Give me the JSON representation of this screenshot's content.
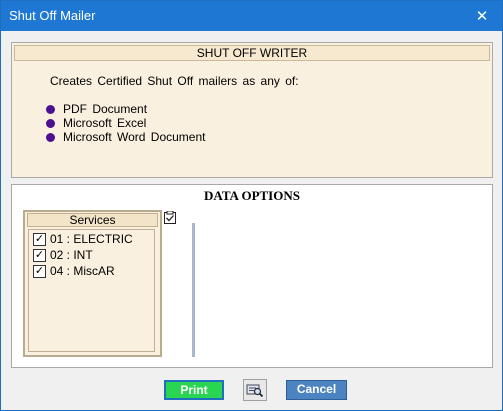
{
  "window": {
    "title": "Shut Off Mailer",
    "close_glyph": "✕"
  },
  "writer_panel": {
    "header": "SHUT OFF WRITER",
    "description": "Creates Certified Shut Off mailers as any of:",
    "formats": [
      "PDF Document",
      "Microsoft Excel",
      "Microsoft Word Document"
    ],
    "bullet_color": "#4b0f8f"
  },
  "data_options": {
    "header": "DATA OPTIONS",
    "services": {
      "caption": "Services",
      "items": [
        {
          "label": "01 : ELECTRIC",
          "checked": true
        },
        {
          "label": "02 : INT",
          "checked": true
        },
        {
          "label": "04 : MiscAR",
          "checked": true
        }
      ],
      "toggle_icon": "checklist-icon"
    }
  },
  "buttons": {
    "print": "Print",
    "preview_icon": "print-preview-icon",
    "cancel": "Cancel"
  },
  "colors": {
    "titlebar": "#1e78d3",
    "print_button": "#2ad651",
    "cancel_button": "#4c84c2",
    "panel_background": "#faf0df"
  }
}
